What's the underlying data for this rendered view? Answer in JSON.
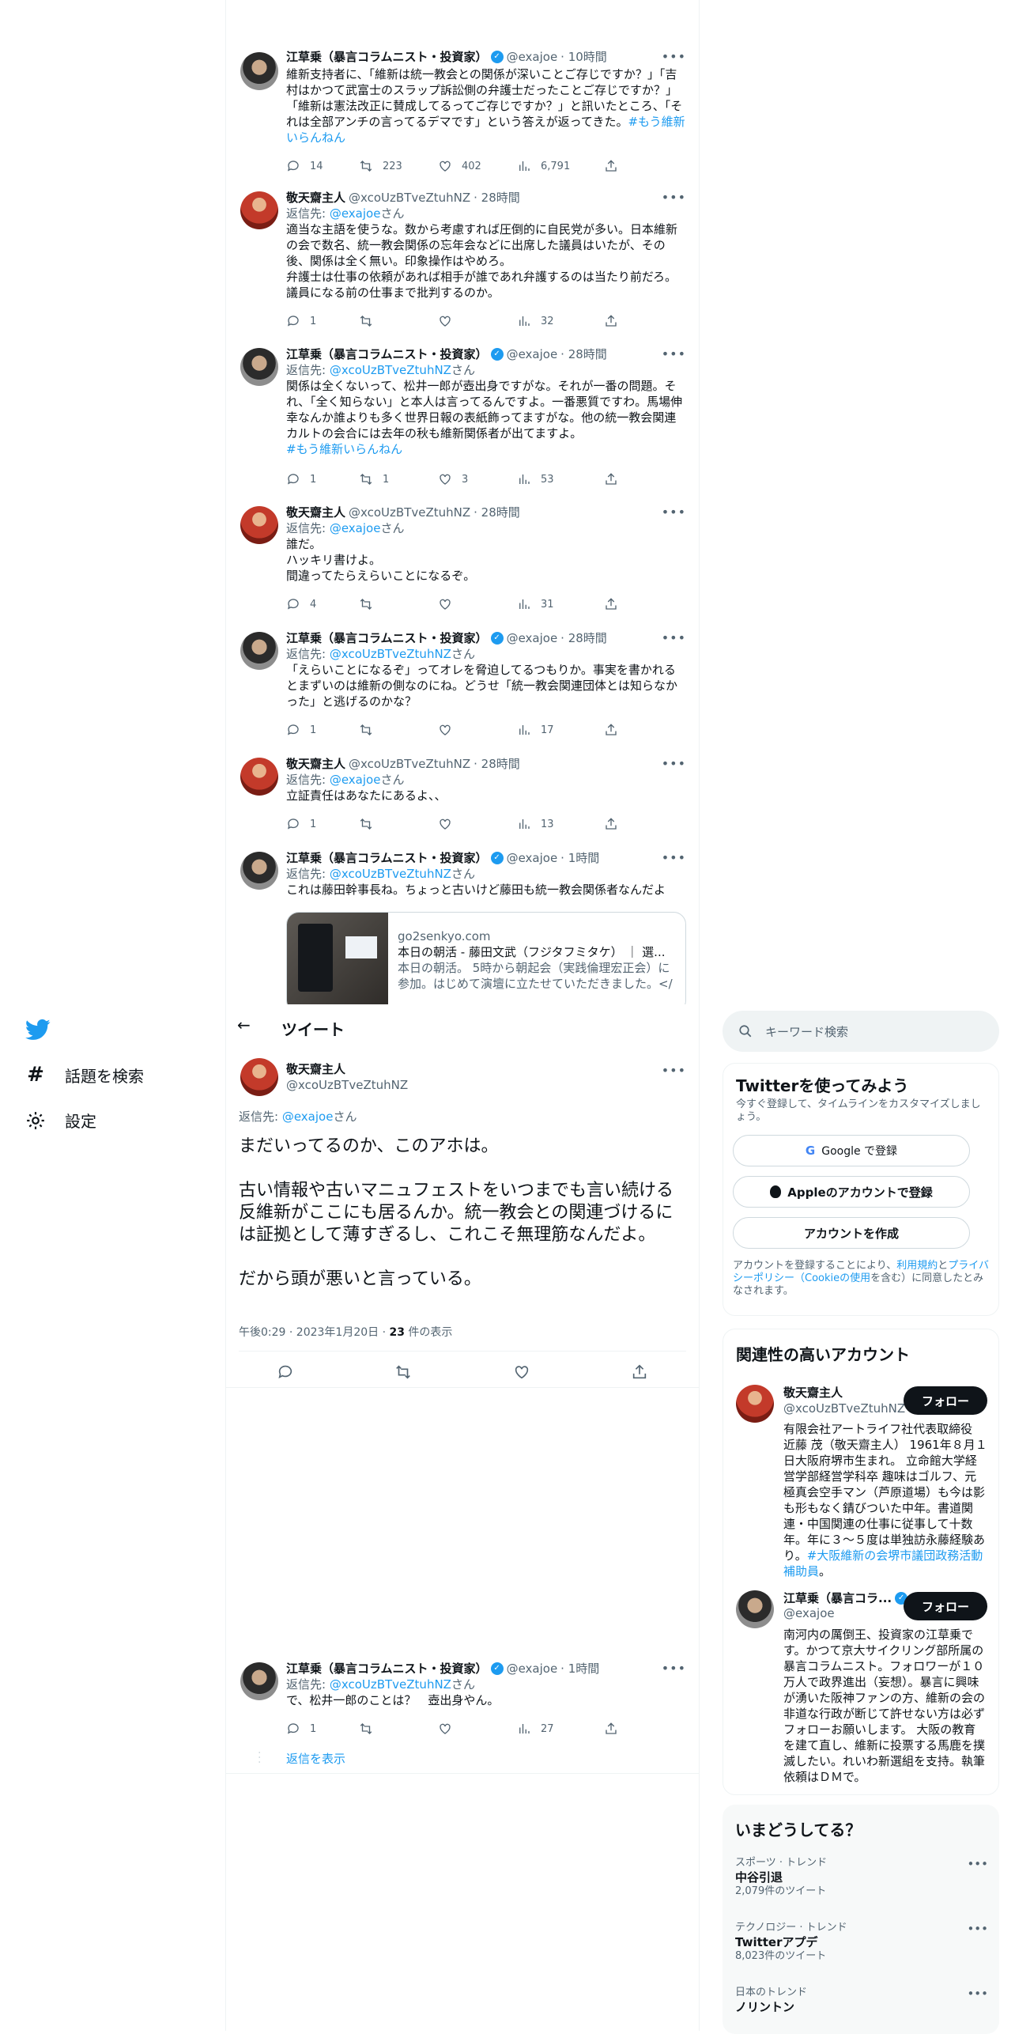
{
  "nav": {
    "explore_label": "話題を検索",
    "settings_label": "設定"
  },
  "thread": [
    {
      "name": "江草乗（暴言コラムニスト・投資家）",
      "handle": "@exajoe",
      "time": "· 10時間",
      "text": "維新支持者に、「維新は統一教会との関係が深いことご存じですか？」「吉村はかつて武富士のスラップ訴訟側の弁護士だったことご存じですか？」「維新は憲法改正に賛成してるってご存じですか？」と訊いたところ、「それは全部アンチの言ってるデマです」という答えが返ってきた。",
      "hashtag": "#もう維新いらんねん",
      "replies": "14",
      "retweets": "223",
      "likes": "402",
      "views": "6,791"
    },
    {
      "name": "敬天齋主人",
      "handle": "@xcoUzBTveZtuhNZ",
      "time": "· 28時間",
      "reply_prefix": "返信先: ",
      "reply_to": "@exajoe",
      "reply_suffix": "さん",
      "text": "適当な主語を使うな。数から考慮すれば圧倒的に自民党が多い。日本維新の会で数名、統一教会関係の忘年会などに出席した議員はいたが、その後、関係は全く無い。印象操作はやめろ。\n弁護士は仕事の依頼があれば相手が誰であれ弁護するのは当たり前だろ。議員になる前の仕事まで批判するのか。",
      "replies": "1",
      "retweets": "",
      "likes": "",
      "views": "32"
    },
    {
      "name": "江草乗（暴言コラムニスト・投資家）",
      "handle": "@exajoe",
      "time": "· 28時間",
      "reply_prefix": "返信先: ",
      "reply_to": "@xcoUzBTveZtuhNZ",
      "reply_suffix": "さん",
      "text": "関係は全くないって、松井一郎が壺出身ですがな。それが一番の問題。それ、「全く知らない」と本人は言ってるんですよ。一番悪質ですわ。馬場伸幸なんか誰よりも多く世界日報の表紙飾ってますがな。他の統一教会関連カルトの会合には去年の秋も維新関係者が出てますよ。",
      "hashtag": "#もう維新いらんねん",
      "replies": "1",
      "retweets": "1",
      "likes": "3",
      "views": "53"
    },
    {
      "name": "敬天齋主人",
      "handle": "@xcoUzBTveZtuhNZ",
      "time": "· 28時間",
      "reply_prefix": "返信先: ",
      "reply_to": "@exajoe",
      "reply_suffix": "さん",
      "text": "誰だ。\nハッキリ書けよ。\n間違ってたらえらいことになるぞ。",
      "replies": "4",
      "retweets": "",
      "likes": "",
      "views": "31"
    },
    {
      "name": "江草乗（暴言コラムニスト・投資家）",
      "handle": "@exajoe",
      "time": "· 28時間",
      "reply_prefix": "返信先: ",
      "reply_to": "@xcoUzBTveZtuhNZ",
      "reply_suffix": "さん",
      "text": "「えらいことになるぞ」ってオレを脅迫してるつもりか。事実を書かれるとまずいのは維新の側なのにね。どうせ「統一教会関連団体とは知らなかった」と逃げるのかな？",
      "replies": "1",
      "retweets": "",
      "likes": "",
      "views": "17"
    },
    {
      "name": "敬天齋主人",
      "handle": "@xcoUzBTveZtuhNZ",
      "time": "· 28時間",
      "reply_prefix": "返信先: ",
      "reply_to": "@exajoe",
      "reply_suffix": "さん",
      "text": "立証責任はあなたにあるよ、、",
      "replies": "1",
      "retweets": "",
      "likes": "",
      "views": "13"
    },
    {
      "name": "江草乗（暴言コラムニスト・投資家）",
      "handle": "@exajoe",
      "time": "· 1時間",
      "reply_prefix": "返信先: ",
      "reply_to": "@xcoUzBTveZtuhNZ",
      "reply_suffix": "さん",
      "text": "これは藤田幹事長ね。ちょっと古いけど藤田も統一教会関係者なんだよ",
      "card": {
        "domain": "go2senkyo.com",
        "title": "本日の朝活 - 藤田文武（フジタフミタケ） ｜ 選...",
        "desc": "本日の朝活。 5時から朝起会（実践倫理宏正会）に参加。はじめて演壇に立たせていただきました。</"
      }
    }
  ],
  "focus": {
    "back_title": "ツイート",
    "name": "敬天齋主人",
    "handle": "@xcoUzBTveZtuhNZ",
    "reply_prefix": "返信先: ",
    "reply_to": "@exajoe",
    "reply_suffix": "さん",
    "text": "まだいってるのか、このアホは。\n\n古い情報や古いマニュフェストをいつまでも言い続ける反維新がここにも居るんか。統一教会との関連づけるには証拠として薄すぎるし、これこそ無理筋なんだよ。\n\nだから頭が悪いと言っている。",
    "meta_prefix": "午後0:29 · 2023年1月20日 · ",
    "views": "23",
    "views_suffix": " 件の表示"
  },
  "last_reply": {
    "name": "江草乗（暴言コラムニスト・投資家）",
    "handle": "@exajoe",
    "time": "· 1時間",
    "reply_prefix": "返信先: ",
    "reply_to": "@xcoUzBTveZtuhNZ",
    "reply_suffix": "さん",
    "text": "で、松井一郎のことは？　壺出身やん。",
    "replies": "1",
    "views": "27",
    "show_replies": "返信を表示"
  },
  "right": {
    "search_placeholder": "キーワード検索",
    "signup": {
      "title": "Twitterを使ってみよう",
      "subtitle": "今すぐ登録して、タイムラインをカスタマイズしましょう。",
      "google": "Google で登録",
      "apple": "Appleのアカウントで登録",
      "create": "アカウントを作成",
      "legal_1": "アカウントを登録することにより、",
      "legal_link1": "利用規約",
      "legal_2": "と",
      "legal_link2": "プライバシーポリシー（Cookieの使用",
      "legal_3": "を含む）に同意したとみなされます。"
    },
    "related": {
      "title": "関連性の高いアカウント",
      "follow": "フォロー",
      "accounts": [
        {
          "name": "敬天齋主人",
          "handle": "@xcoUzBTveZtuhNZ",
          "bio": "有限会社アートライフ社代表取締役 近藤 茂（敬天齋主人） 1961年８月１日大阪府堺市生まれ。 立命館大学経営学部経営学科卒 趣味はゴルフ、元極真会空手マン（芦原道場）も今は影も形もなく錆びついた中年。書道関連・中国関連の仕事に従事して十数年。年に３～５度は単独訪永藤経験あり。",
          "hashtag": "#大阪維新の会堺市議団政務活動補助員",
          "end": "。"
        },
        {
          "name": "江草乗（暴言コラ...",
          "handle": "@exajoe",
          "bio": "南河内の厲倒王、投資家の江草乗です。かつて京大サイクリング部所属の暴言コラムニスト。フォロワーが１０万人で政界進出（妄想）。暴言に興味が湧いた阪神ファンの方、維新の会の非道な行政が断じて許せない方は必ずフォローお願いします。 大阪の教育を建て直し、維新に投票する馬鹿を撲滅したい。れいわ新選組を支持。執筆依頼はＤＭで。"
        }
      ]
    },
    "trends": {
      "title": "いまどうしてる？",
      "items": [
        {
          "category": "スポーツ · トレンド",
          "name": "中谷引退",
          "count": "2,079件のツイート"
        },
        {
          "category": "テクノロジー · トレンド",
          "name": "Twitterアプデ",
          "count": "8,023件のツイート"
        },
        {
          "category": "日本のトレンド",
          "name": "ノリントン",
          "count": ""
        }
      ]
    }
  }
}
